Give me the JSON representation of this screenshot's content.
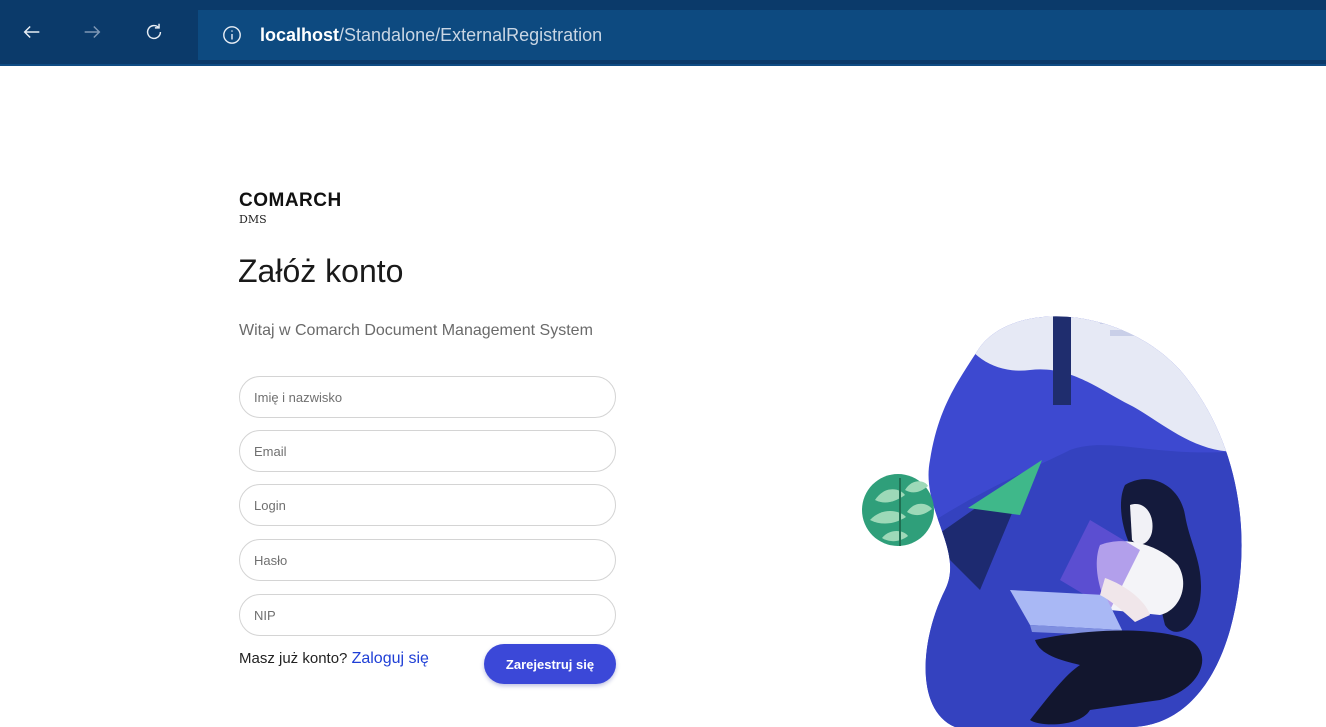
{
  "browser": {
    "url_host": "localhost",
    "url_path": "/Standalone/ExternalRegistration"
  },
  "logo": {
    "brand": "COMARCH",
    "product": "DMS"
  },
  "form": {
    "title": "Załóż konto",
    "subtitle": "Witaj w Comarch Document Management System",
    "fields": {
      "name_placeholder": "Imię i nazwisko",
      "email_placeholder": "Email",
      "login_placeholder": "Login",
      "password_placeholder": "Hasło",
      "nip_placeholder": "NIP"
    },
    "have_account_text": "Masz już konto?",
    "login_link": "Zaloguj się",
    "register_button": "Zarejestruj się"
  },
  "colors": {
    "browser_bar": "#0b3a6a",
    "accent": "#3b48d8",
    "link": "#1f3fd6"
  },
  "icons": {
    "back": "arrow-left-icon",
    "forward": "arrow-right-icon",
    "reload": "reload-icon",
    "info": "info-circle-icon"
  }
}
